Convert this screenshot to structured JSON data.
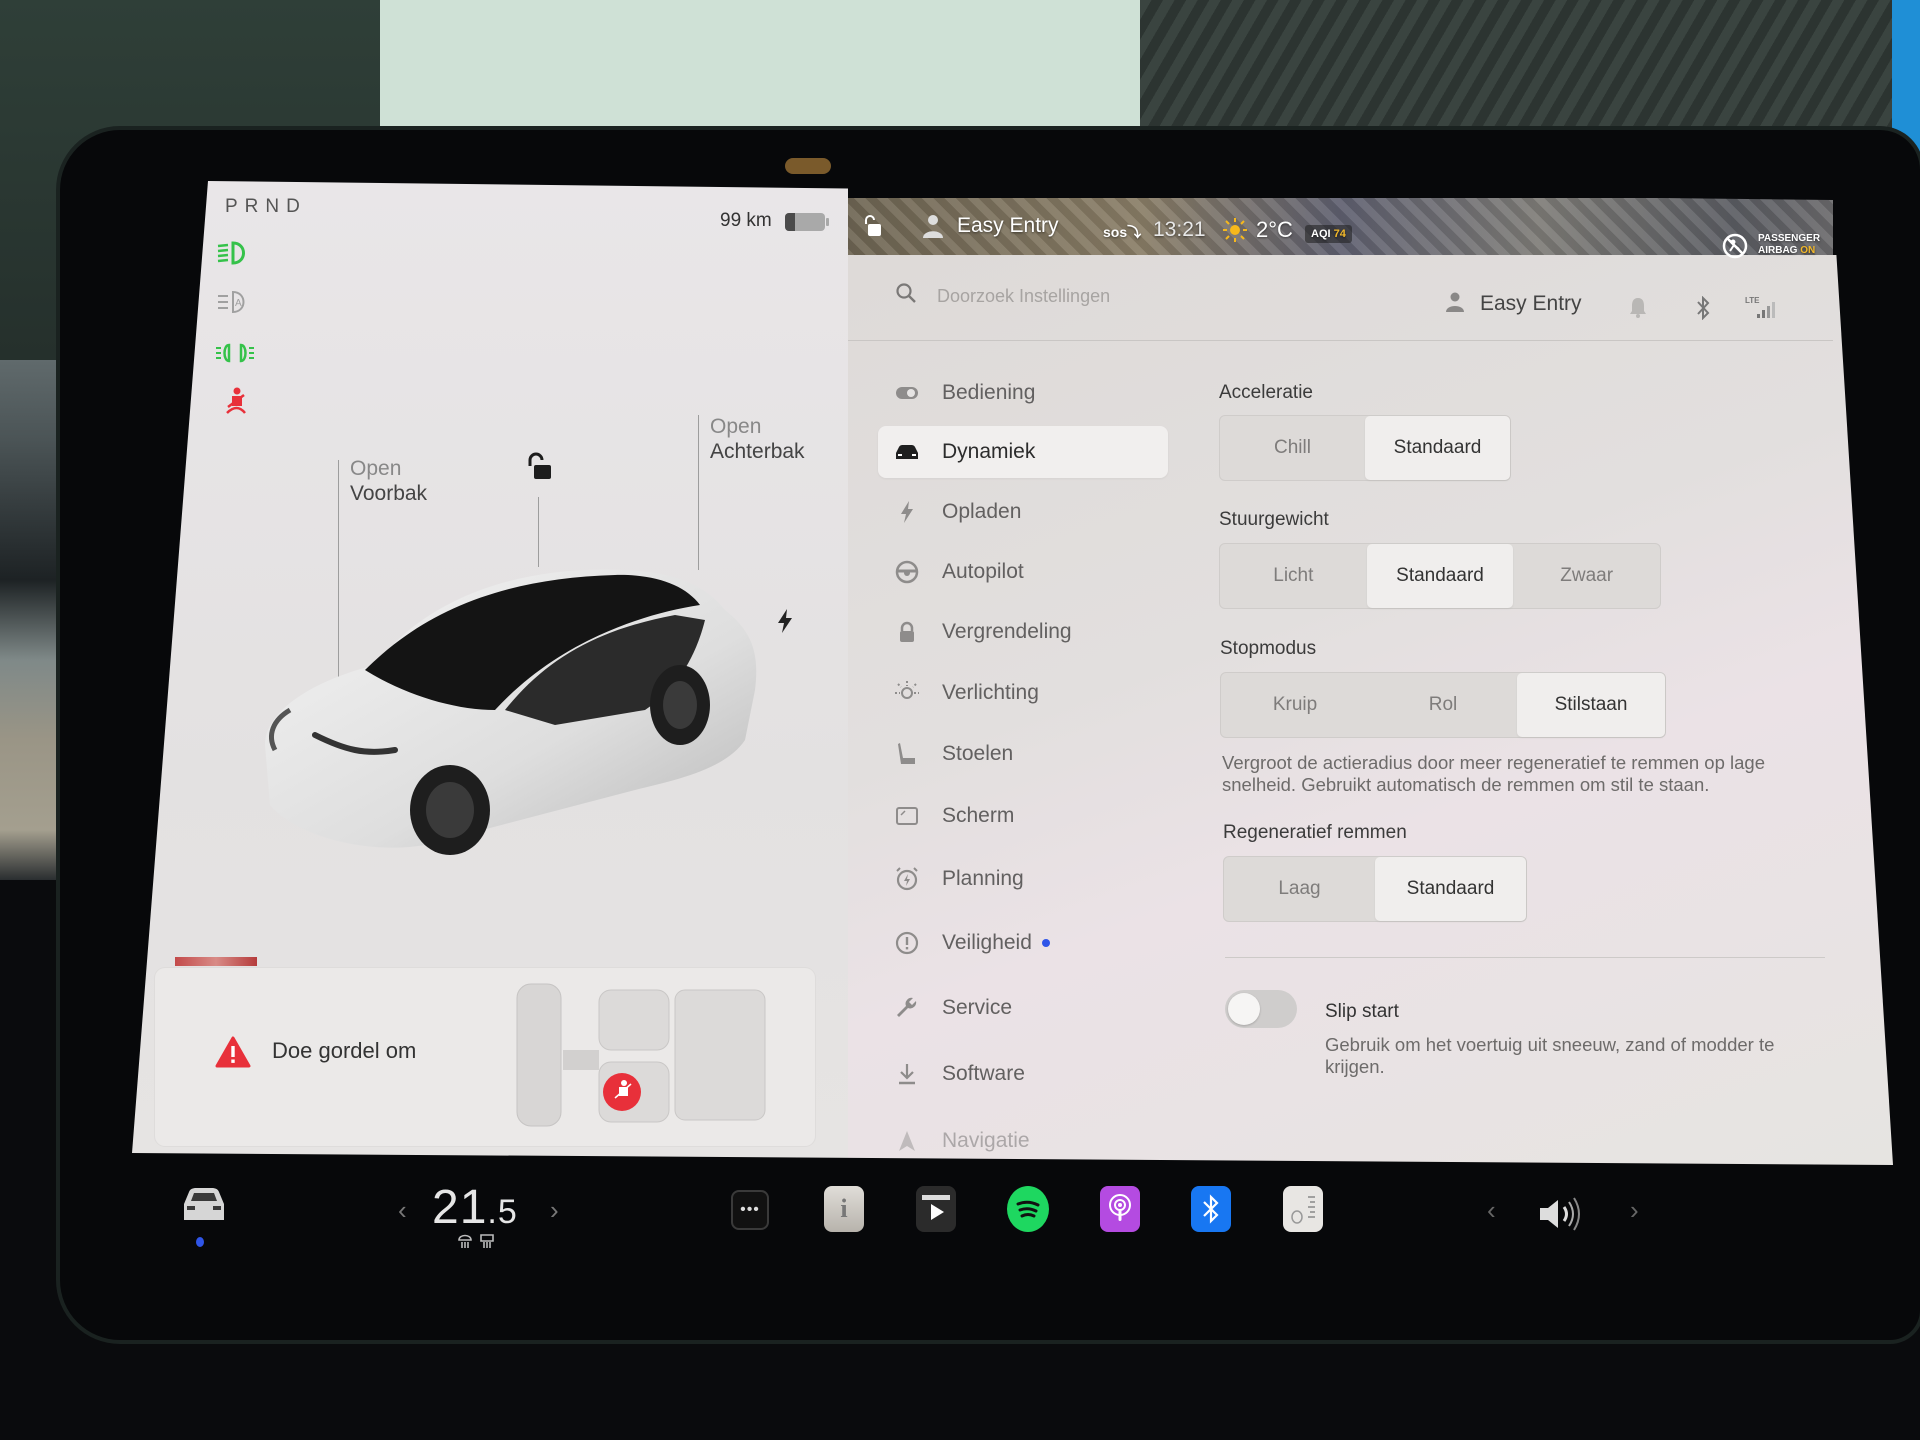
{
  "status": {
    "gear_indicator": "PRND",
    "range": "99 km",
    "battery_level_pct": 25,
    "tell_tales": [
      "low-beam-icon",
      "auto-high-beam-icon",
      "parking-lights-icon",
      "seatbelt-warning-icon"
    ]
  },
  "car_panel": {
    "frunk": {
      "action": "Open",
      "label": "Voorbak"
    },
    "trunk": {
      "action": "Open",
      "label": "Achterbak"
    },
    "lock_state": "unlocked",
    "alert": {
      "text": "Doe gordel om",
      "icon": "warning-icon"
    }
  },
  "top_bar": {
    "profile": "Easy Entry",
    "sos": "SOS",
    "time": "13:21",
    "temperature": "2°C",
    "aqi_label": "AQI",
    "aqi_value": "74",
    "airbag_line1": "PASSENGER",
    "airbag_line2": "AIRBAG",
    "airbag_state": "ON"
  },
  "settings_header": {
    "search_placeholder": "Doorzoek Instellingen",
    "profile": "Easy Entry"
  },
  "nav": {
    "items": [
      {
        "label": "Bediening",
        "icon": "toggle-icon"
      },
      {
        "label": "Dynamiek",
        "icon": "car-icon",
        "active": true
      },
      {
        "label": "Opladen",
        "icon": "bolt-icon"
      },
      {
        "label": "Autopilot",
        "icon": "steering-wheel-icon"
      },
      {
        "label": "Vergrendeling",
        "icon": "lock-icon"
      },
      {
        "label": "Verlichting",
        "icon": "light-icon"
      },
      {
        "label": "Stoelen",
        "icon": "seat-icon"
      },
      {
        "label": "Scherm",
        "icon": "display-icon"
      },
      {
        "label": "Planning",
        "icon": "alarm-clock-icon"
      },
      {
        "label": "Veiligheid",
        "icon": "alert-circle-icon",
        "badge": true
      },
      {
        "label": "Service",
        "icon": "wrench-icon"
      },
      {
        "label": "Software",
        "icon": "download-icon"
      },
      {
        "label": "Navigatie",
        "icon": "navigation-icon"
      }
    ]
  },
  "dynamics": {
    "acceleratie": {
      "title": "Acceleratie",
      "options": [
        "Chill",
        "Standaard"
      ],
      "selected": "Standaard"
    },
    "stuurgewicht": {
      "title": "Stuurgewicht",
      "options": [
        "Licht",
        "Standaard",
        "Zwaar"
      ],
      "selected": "Standaard"
    },
    "stopmodus": {
      "title": "Stopmodus",
      "options": [
        "Kruip",
        "Rol",
        "Stilstaan"
      ],
      "selected": "Stilstaan",
      "description": "Vergroot de actieradius door meer regeneratief te remmen op lage snelheid. Gebruikt automatisch de remmen om stil te staan."
    },
    "regeneratief": {
      "title": "Regeneratief remmen",
      "options": [
        "Laag",
        "Standaard"
      ],
      "selected": "Standaard"
    },
    "slip_start": {
      "title": "Slip start",
      "enabled": false,
      "description": "Gebruik om het voertuig uit sneeuw, zand of modder te krijgen."
    }
  },
  "taskbar": {
    "cabin_temp_int": "21",
    "cabin_temp_dec": ".5",
    "apps": [
      "more-icon",
      "manual-icon",
      "video-icon",
      "spotify-icon",
      "podcasts-icon",
      "bluetooth-icon",
      "dashcam-icon"
    ],
    "colors": {
      "spotify": "#1ed760",
      "podcasts": "#b44be1",
      "bluetooth": "#1877f2"
    }
  }
}
